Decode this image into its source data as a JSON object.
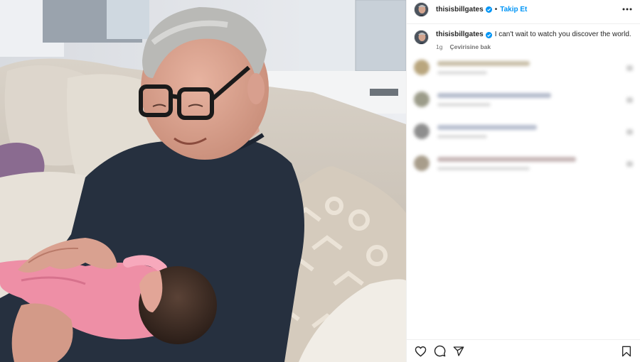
{
  "post": {
    "username": "thisisbillgates",
    "verified": true,
    "separator": "•",
    "follow_label": "Takip Et",
    "more_icon": "more-horizontal-icon"
  },
  "caption": {
    "username": "thisisbillgates",
    "text": "I can't wait to watch you discover the world.",
    "time": "1g",
    "translate_label": "Çevirisine bak"
  },
  "comments": [
    {
      "blurred": true,
      "avatar_color": "#b9a67e"
    },
    {
      "blurred": true,
      "avatar_color": "#9c9c8a"
    },
    {
      "blurred": true,
      "avatar_color": "#8e8e8e"
    },
    {
      "blurred": true,
      "avatar_color": "#a89d8b"
    }
  ],
  "actions": {
    "like_icon": "heart-icon",
    "comment_icon": "comment-icon",
    "share_icon": "send-icon",
    "save_icon": "bookmark-icon"
  },
  "colors": {
    "link_blue": "#0095f6",
    "text": "#262626",
    "muted": "#737373",
    "verified_blue": "#0095f6"
  }
}
